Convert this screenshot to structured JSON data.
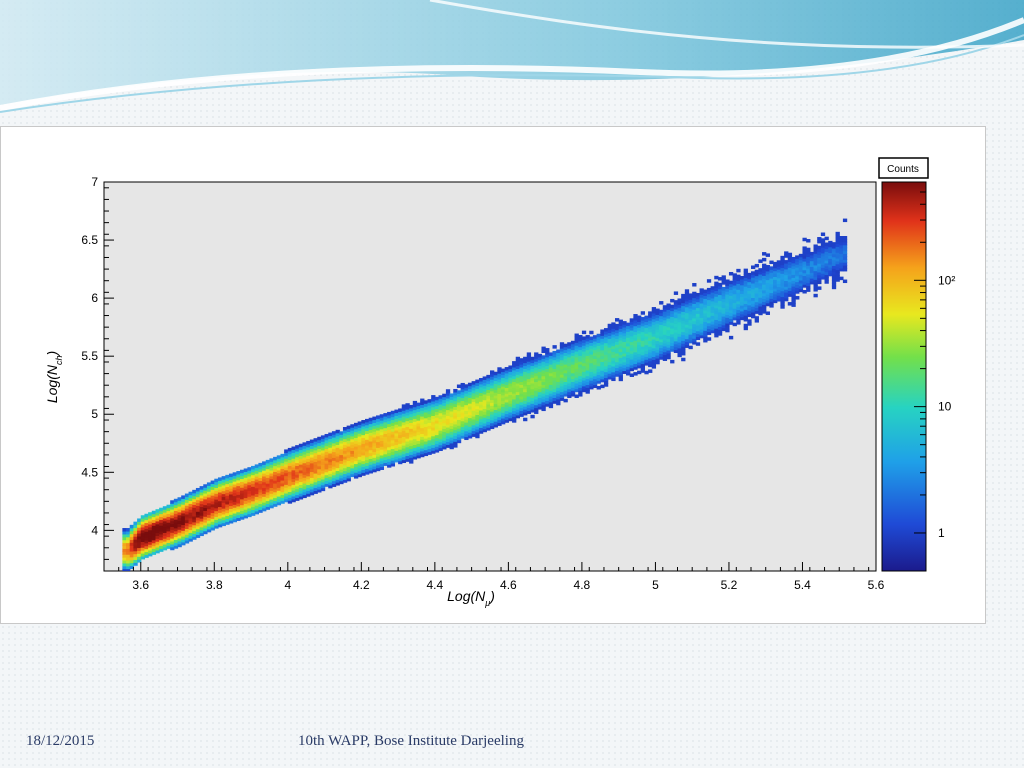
{
  "footer": {
    "date": "18/12/2015",
    "event": "10th WAPP, Bose Institute Darjeeling"
  },
  "colors": {
    "banner_light": "#cfe9f2",
    "banner_mid": "#7cc6dd",
    "banner_dark": "#3aa3c7",
    "plot_bg": "#e6e6e6",
    "footer_text": "#2a3b66"
  },
  "chart_data": {
    "type": "heatmap",
    "title": "",
    "xlabel": "Log(N_μ)",
    "ylabel": "Log(N_ch)",
    "xlim": [
      3.5,
      5.6
    ],
    "ylim": [
      3.65,
      7.0
    ],
    "x_ticks": [
      "3.6",
      "3.8",
      "4",
      "4.2",
      "4.4",
      "4.6",
      "4.8",
      "5",
      "5.2",
      "5.4",
      "5.6"
    ],
    "x_tick_values": [
      3.6,
      3.8,
      4.0,
      4.2,
      4.4,
      4.6,
      4.8,
      5.0,
      5.2,
      5.4,
      5.6
    ],
    "y_ticks": [
      "4",
      "4.5",
      "5",
      "5.5",
      "6",
      "6.5",
      "7"
    ],
    "y_tick_values": [
      4.0,
      4.5,
      5.0,
      5.5,
      6.0,
      6.5,
      7.0
    ],
    "colorbar": {
      "title": "Counts",
      "scale": "log",
      "range": [
        0.5,
        600
      ],
      "tick_labels": [
        "1",
        "10",
        "10²"
      ],
      "tick_values": [
        1,
        10,
        100
      ]
    },
    "ridge": [
      {
        "x": 3.56,
        "y": 3.82
      },
      {
        "x": 3.6,
        "y": 3.93
      },
      {
        "x": 3.7,
        "y": 4.06
      },
      {
        "x": 3.8,
        "y": 4.22
      },
      {
        "x": 3.9,
        "y": 4.33
      },
      {
        "x": 4.0,
        "y": 4.46
      },
      {
        "x": 4.2,
        "y": 4.7
      },
      {
        "x": 4.4,
        "y": 4.9
      },
      {
        "x": 4.6,
        "y": 5.17
      },
      {
        "x": 4.8,
        "y": 5.42
      },
      {
        "x": 5.0,
        "y": 5.66
      },
      {
        "x": 5.2,
        "y": 5.95
      },
      {
        "x": 5.4,
        "y": 6.22
      },
      {
        "x": 5.5,
        "y": 6.36
      }
    ],
    "peak": {
      "x": 3.72,
      "y": 4.08,
      "counts": 550
    },
    "legend_position": "right"
  }
}
